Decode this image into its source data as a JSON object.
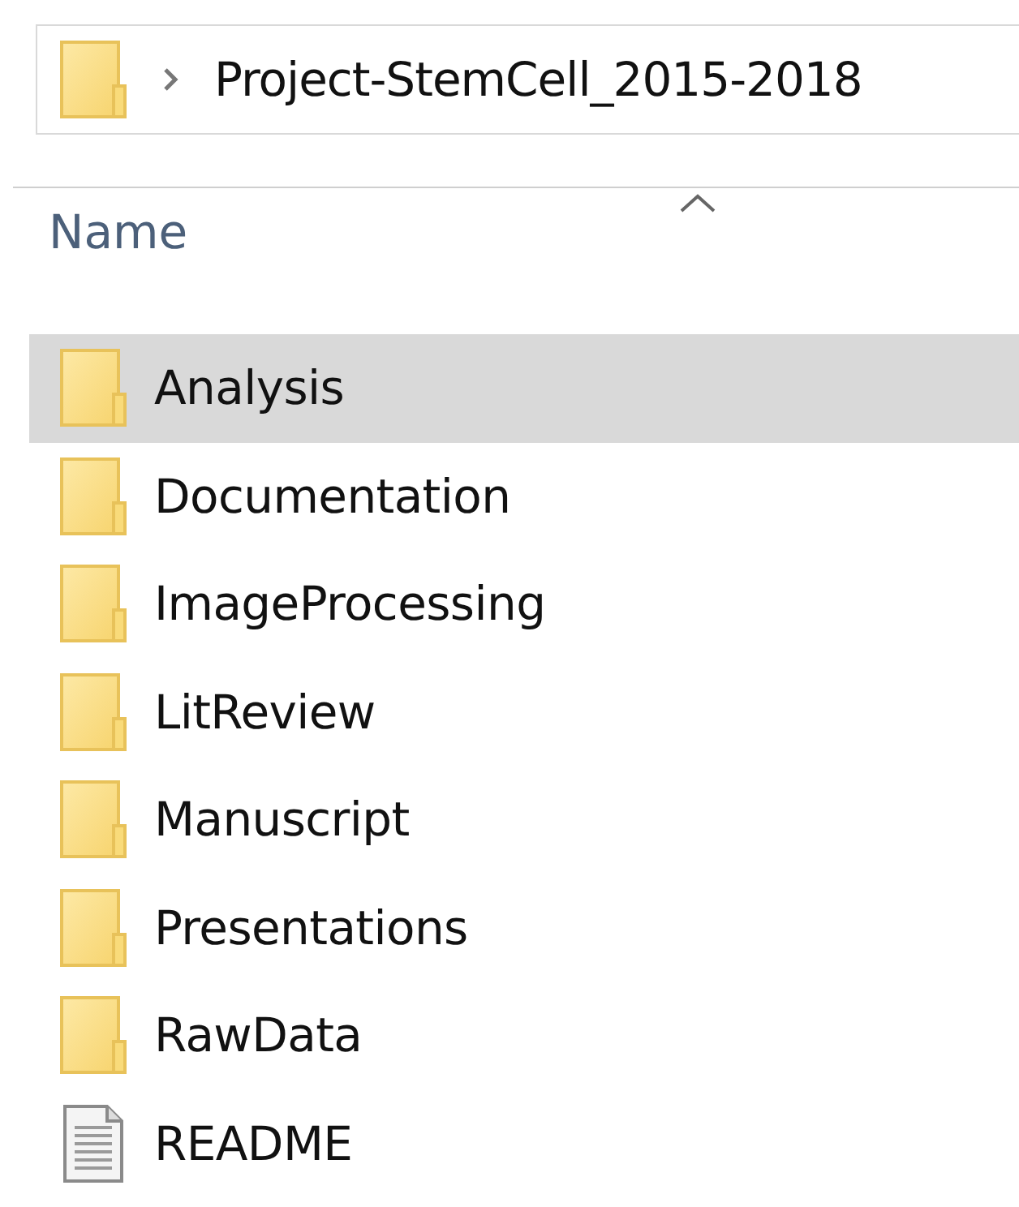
{
  "address_bar": {
    "path": "Project-StemCell_2015-2018"
  },
  "column_header": {
    "label": "Name",
    "sorted": true
  },
  "items": [
    {
      "name": "Analysis",
      "kind": "folder",
      "selected": true
    },
    {
      "name": "Documentation",
      "kind": "folder",
      "selected": false
    },
    {
      "name": "ImageProcessing",
      "kind": "folder",
      "selected": false
    },
    {
      "name": "LitReview",
      "kind": "folder",
      "selected": false
    },
    {
      "name": "Manuscript",
      "kind": "folder",
      "selected": false
    },
    {
      "name": "Presentations",
      "kind": "folder",
      "selected": false
    },
    {
      "name": "RawData",
      "kind": "folder",
      "selected": false
    },
    {
      "name": "README",
      "kind": "file",
      "selected": false
    }
  ]
}
